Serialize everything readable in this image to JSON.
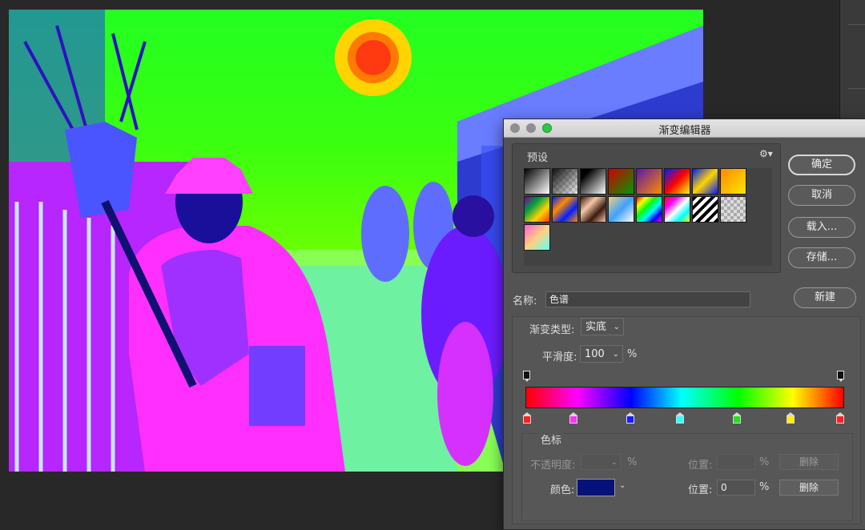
{
  "dialog": {
    "title": "渐变编辑器",
    "presets_label": "预设",
    "gear_icon": "gear-icon",
    "buttons": {
      "ok": "确定",
      "cancel": "取消",
      "load": "载入...",
      "save": "存储...",
      "new": "新建"
    },
    "name_label": "名称:",
    "name_value": "色谱",
    "gradient_type_label": "渐变类型:",
    "gradient_type_value": "实底",
    "smoothness_label": "平滑度:",
    "smoothness_value": "100",
    "smoothness_unit": "%",
    "stops_section_label": "色标",
    "opacity_label": "不透明度:",
    "opacity_unit": "%",
    "opacity_location_label": "位置:",
    "opacity_location_unit": "%",
    "opacity_delete": "删除",
    "color_label": "颜色:",
    "color_location_label": "位置:",
    "color_location_value": "0",
    "color_location_unit": "%",
    "color_delete": "删除",
    "selected_color": "#06127a",
    "gradient_colors": [
      "#ff0000",
      "#ff00ff",
      "#0000ff",
      "#00ffff",
      "#00ff00",
      "#ffff00",
      "#ff0000"
    ],
    "color_stop_colors": [
      "#ff2020",
      "#ff30ff",
      "#1a1aff",
      "#33ffff",
      "#22e022",
      "#ffee00",
      "#ff2020"
    ]
  }
}
